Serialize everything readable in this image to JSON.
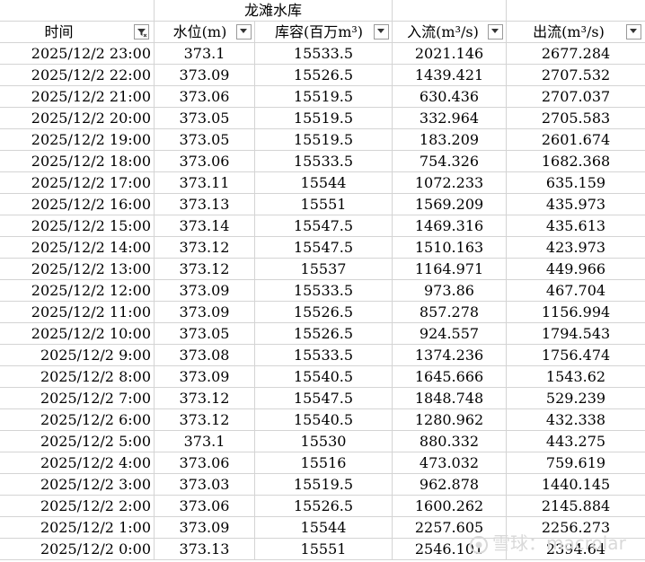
{
  "sheet_title": "龙滩水库",
  "headers": {
    "time": "时间",
    "level": "水位(m)",
    "storage": "库容(百万m³)",
    "inflow": "入流(m³/s)",
    "outflow": "出流(m³/s)"
  },
  "rows": [
    {
      "time": "2025/12/2 23:00",
      "level": "373.1",
      "storage": "15533.5",
      "inflow": "2021.146",
      "outflow": "2677.284"
    },
    {
      "time": "2025/12/2 22:00",
      "level": "373.09",
      "storage": "15526.5",
      "inflow": "1439.421",
      "outflow": "2707.532"
    },
    {
      "time": "2025/12/2 21:00",
      "level": "373.06",
      "storage": "15519.5",
      "inflow": "630.436",
      "outflow": "2707.037"
    },
    {
      "time": "2025/12/2 20:00",
      "level": "373.05",
      "storage": "15519.5",
      "inflow": "332.964",
      "outflow": "2705.583"
    },
    {
      "time": "2025/12/2 19:00",
      "level": "373.05",
      "storage": "15519.5",
      "inflow": "183.209",
      "outflow": "2601.674"
    },
    {
      "time": "2025/12/2 18:00",
      "level": "373.06",
      "storage": "15533.5",
      "inflow": "754.326",
      "outflow": "1682.368"
    },
    {
      "time": "2025/12/2 17:00",
      "level": "373.11",
      "storage": "15544",
      "inflow": "1072.233",
      "outflow": "635.159"
    },
    {
      "time": "2025/12/2 16:00",
      "level": "373.13",
      "storage": "15551",
      "inflow": "1569.209",
      "outflow": "435.973"
    },
    {
      "time": "2025/12/2 15:00",
      "level": "373.14",
      "storage": "15547.5",
      "inflow": "1469.316",
      "outflow": "435.613"
    },
    {
      "time": "2025/12/2 14:00",
      "level": "373.12",
      "storage": "15547.5",
      "inflow": "1510.163",
      "outflow": "423.973"
    },
    {
      "time": "2025/12/2 13:00",
      "level": "373.12",
      "storage": "15537",
      "inflow": "1164.971",
      "outflow": "449.966"
    },
    {
      "time": "2025/12/2 12:00",
      "level": "373.09",
      "storage": "15533.5",
      "inflow": "973.86",
      "outflow": "467.704"
    },
    {
      "time": "2025/12/2 11:00",
      "level": "373.09",
      "storage": "15526.5",
      "inflow": "857.278",
      "outflow": "1156.994"
    },
    {
      "time": "2025/12/2 10:00",
      "level": "373.05",
      "storage": "15526.5",
      "inflow": "924.557",
      "outflow": "1794.543"
    },
    {
      "time": "2025/12/2 9:00",
      "level": "373.08",
      "storage": "15533.5",
      "inflow": "1374.236",
      "outflow": "1756.474"
    },
    {
      "time": "2025/12/2 8:00",
      "level": "373.09",
      "storage": "15540.5",
      "inflow": "1645.666",
      "outflow": "1543.62"
    },
    {
      "time": "2025/12/2 7:00",
      "level": "373.12",
      "storage": "15547.5",
      "inflow": "1848.748",
      "outflow": "529.239"
    },
    {
      "time": "2025/12/2 6:00",
      "level": "373.12",
      "storage": "15540.5",
      "inflow": "1280.962",
      "outflow": "432.338"
    },
    {
      "time": "2025/12/2 5:00",
      "level": "373.1",
      "storage": "15530",
      "inflow": "880.332",
      "outflow": "443.275"
    },
    {
      "time": "2025/12/2 4:00",
      "level": "373.06",
      "storage": "15516",
      "inflow": "473.032",
      "outflow": "759.619"
    },
    {
      "time": "2025/12/2 3:00",
      "level": "373.03",
      "storage": "15519.5",
      "inflow": "962.878",
      "outflow": "1440.145"
    },
    {
      "time": "2025/12/2 2:00",
      "level": "373.06",
      "storage": "15526.5",
      "inflow": "1600.262",
      "outflow": "2145.884"
    },
    {
      "time": "2025/12/2 1:00",
      "level": "373.09",
      "storage": "15544",
      "inflow": "2257.605",
      "outflow": "2256.273"
    },
    {
      "time": "2025/12/2 0:00",
      "level": "373.13",
      "storage": "15551",
      "inflow": "2546.101",
      "outflow": "2394.64"
    }
  ],
  "watermark": {
    "text": "雪球：macrolar"
  }
}
